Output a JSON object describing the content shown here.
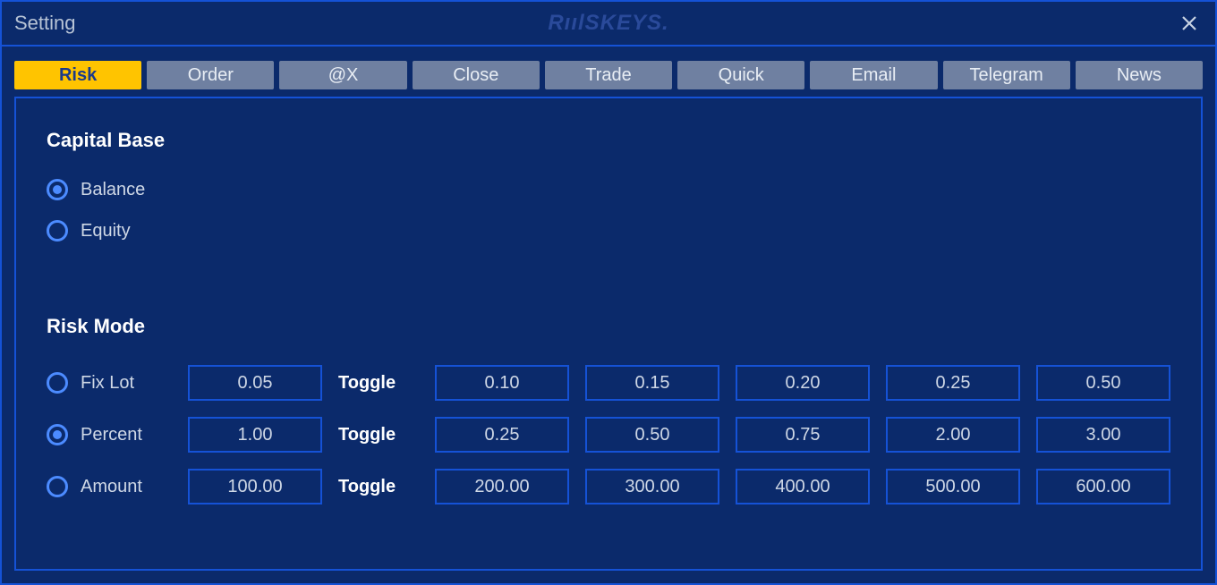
{
  "titlebar": {
    "title": "Setting",
    "brand": "RıılSKEYS."
  },
  "tabs": [
    {
      "label": "Risk",
      "active": true
    },
    {
      "label": "Order",
      "active": false
    },
    {
      "label": "@X",
      "active": false
    },
    {
      "label": "Close",
      "active": false
    },
    {
      "label": "Trade",
      "active": false
    },
    {
      "label": "Quick",
      "active": false
    },
    {
      "label": "Email",
      "active": false
    },
    {
      "label": "Telegram",
      "active": false
    },
    {
      "label": "News",
      "active": false
    }
  ],
  "capital_base": {
    "heading": "Capital Base",
    "options": {
      "balance": {
        "label": "Balance",
        "checked": true
      },
      "equity": {
        "label": "Equity",
        "checked": false
      }
    }
  },
  "risk_mode": {
    "heading": "Risk Mode",
    "toggle_label": "Toggle",
    "rows": {
      "fixlot": {
        "label": "Fix Lot",
        "checked": false,
        "value": "0.05",
        "presets": [
          "0.10",
          "0.15",
          "0.20",
          "0.25",
          "0.50"
        ]
      },
      "percent": {
        "label": "Percent",
        "checked": true,
        "value": "1.00",
        "presets": [
          "0.25",
          "0.50",
          "0.75",
          "2.00",
          "3.00"
        ]
      },
      "amount": {
        "label": "Amount",
        "checked": false,
        "value": "100.00",
        "presets": [
          "200.00",
          "300.00",
          "400.00",
          "500.00",
          "600.00"
        ]
      }
    }
  }
}
